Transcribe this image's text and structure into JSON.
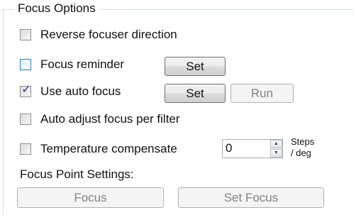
{
  "group_title": "Focus Options",
  "options": [
    {
      "label": "Reverse focuser direction",
      "checked": false
    },
    {
      "label": "Focus reminder",
      "checked": false
    },
    {
      "label": "Use auto focus",
      "checked": true
    },
    {
      "label": "Auto adjust focus per filter",
      "checked": false
    },
    {
      "label": "Temperature compensate",
      "checked": false
    }
  ],
  "buttons": {
    "reminder_set": "Set",
    "autofocus_set": "Set",
    "autofocus_run": "Run",
    "focus": "Focus",
    "set_focus": "Set Focus"
  },
  "temperature": {
    "value": "0",
    "units_line1": "Steps",
    "units_line2": "/ deg"
  },
  "focus_point_label": "Focus Point Settings:"
}
